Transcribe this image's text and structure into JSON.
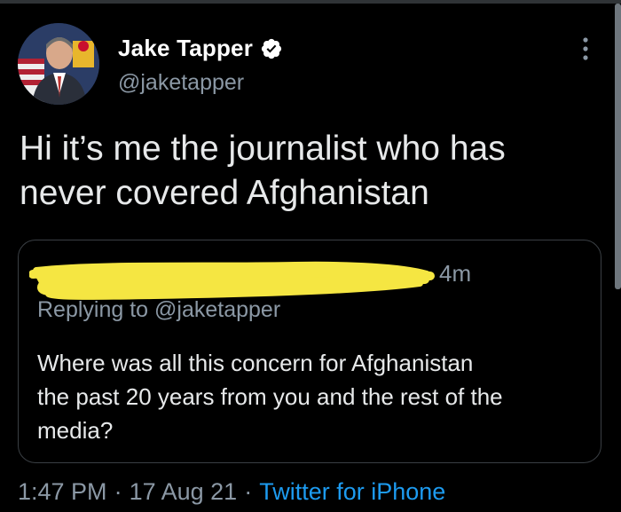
{
  "tweet": {
    "author": {
      "display_name": "Jake Tapper",
      "handle": "@jaketapper",
      "verified": true
    },
    "text": "Hi it’s me the journalist who has\nnever covered Afghanistan",
    "quoted_tweet": {
      "time": "4m",
      "replying_to": "Replying to @jaketapper",
      "text": "Where was all this concern for Afghanistan\nthe past 20 years from you and the rest of the\nmedia?"
    },
    "meta": {
      "time": "1:47 PM",
      "separator": "·",
      "date": "17 Aug 21",
      "source": "Twitter for iPhone"
    }
  },
  "colors": {
    "background": "#000000",
    "text": "#e7e9ea",
    "secondary_text": "#8b98a5",
    "link": "#1d9bf0",
    "verified_badge": "#ffffff",
    "redaction": "#f5e642",
    "border": "#3a3f44"
  },
  "icons": {
    "verified": "verified-badge-icon",
    "more": "more-options-icon"
  }
}
